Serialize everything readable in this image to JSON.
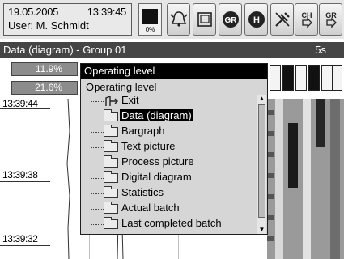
{
  "header": {
    "date": "19.05.2005",
    "time": "13:39:45",
    "user": "User: M. Schmidt",
    "memory_percent_label": "0%"
  },
  "toolbar": {
    "buttons": [
      {
        "name": "alarm-bell-icon"
      },
      {
        "name": "window-icon"
      },
      {
        "name": "gr-icon",
        "label": "GR"
      },
      {
        "name": "h-icon",
        "label": "H"
      },
      {
        "name": "tools-icon"
      },
      {
        "name": "channel-next-icon",
        "label": "CH"
      },
      {
        "name": "group-next-icon",
        "label": "GR"
      }
    ]
  },
  "group_bar": {
    "title": "Data (diagram) - Group 01",
    "rate": "5s"
  },
  "values": [
    "11.9%",
    "21.6%"
  ],
  "timestamps": [
    "13:39:44",
    "13:39:38",
    "13:39:32"
  ],
  "menu": {
    "header": "Operating level",
    "title": "Operating level",
    "items": [
      {
        "label": "Exit"
      },
      {
        "label": "Data (diagram)",
        "selected": true
      },
      {
        "label": "Bargraph"
      },
      {
        "label": "Text picture"
      },
      {
        "label": "Process picture"
      },
      {
        "label": "Digital diagram"
      },
      {
        "label": "Statistics"
      },
      {
        "label": "Actual batch"
      },
      {
        "label": "Last completed batch"
      }
    ]
  },
  "colors": {
    "title_bar": "#454545",
    "menu_header": "#000000",
    "selected_bg": "#000000"
  }
}
